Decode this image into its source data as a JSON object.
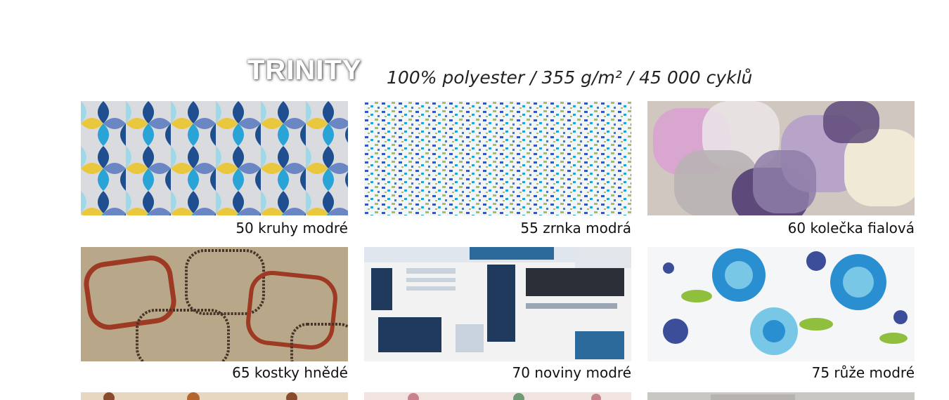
{
  "header": {
    "brand": "TRINITY",
    "spec": "100% polyester / 355 g/m² / 45 000 cyklů"
  },
  "swatches": [
    {
      "label": "50 kruhy modré"
    },
    {
      "label": "55 zrnka modrá"
    },
    {
      "label": "60 kolečka fialová"
    },
    {
      "label": "65 kostky hnědé"
    },
    {
      "label": "70 noviny modré"
    },
    {
      "label": "75 růže modré"
    }
  ],
  "colors": {
    "kruhy": [
      "#1f4f8f",
      "#2aa3d6",
      "#e9c83d",
      "#6b86c4",
      "#9fd8e6"
    ],
    "zrnka": [
      "#2b59c9",
      "#1ea6d8",
      "#9fc74a",
      "#3a7bd5"
    ],
    "kolecka": [
      "#d9a6cf",
      "#5e4a7a",
      "#b7a2c9",
      "#efe9d6",
      "#cfc7c0"
    ],
    "kostky": [
      "#b8a889",
      "#9e3a23",
      "#4a3429"
    ],
    "noviny": [
      "#1f3a5c",
      "#2b6a9a",
      "#f2f2f2"
    ],
    "ruze": [
      "#2a8fd1",
      "#3c4d9a",
      "#8fbf3c",
      "#79c7e6"
    ]
  }
}
